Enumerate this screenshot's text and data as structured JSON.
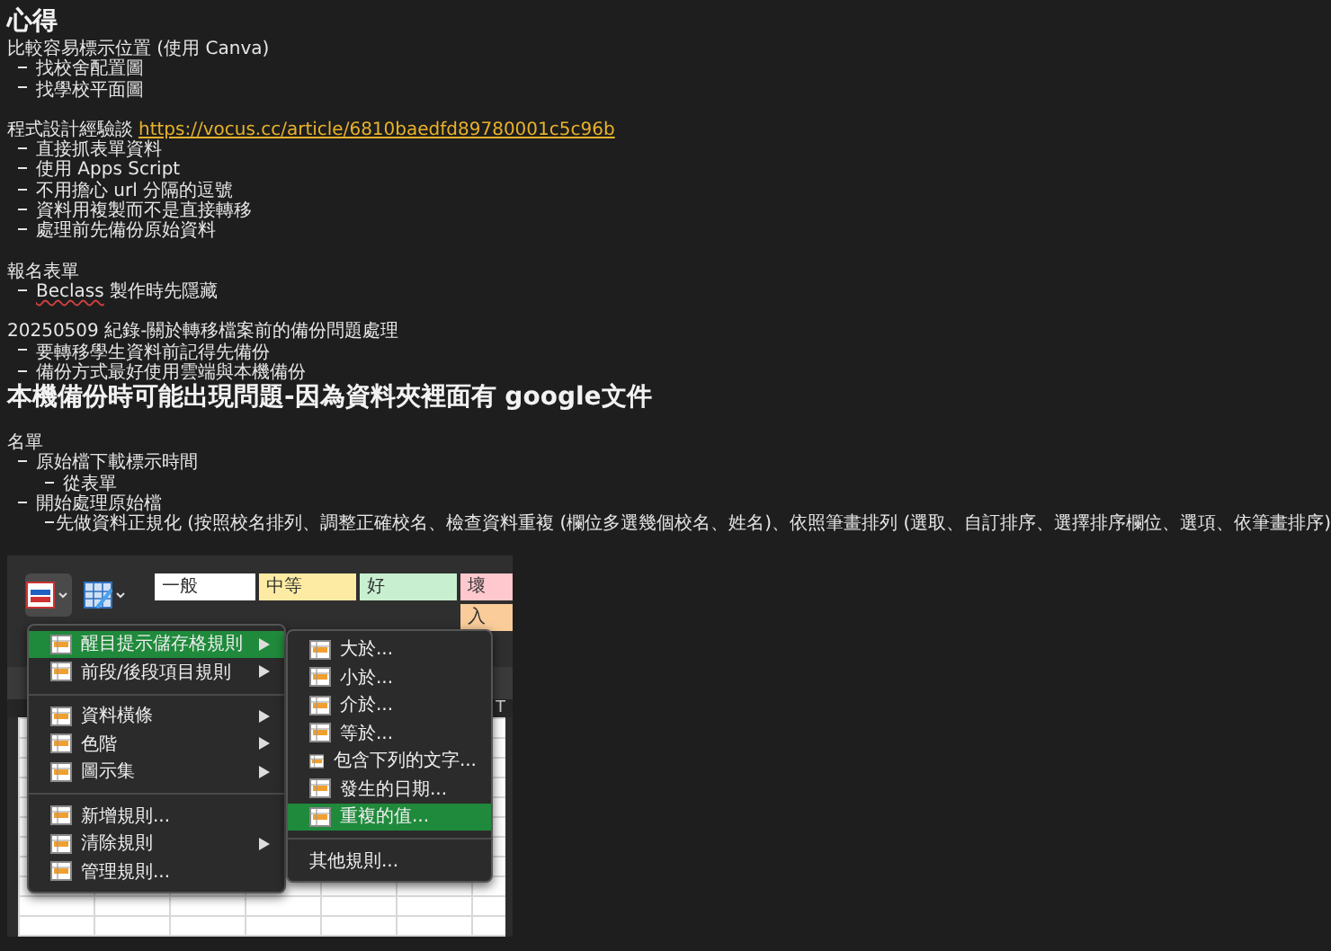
{
  "title": "心得",
  "blocks": [
    {
      "kind": "para",
      "text": "比較容易標示位置 (使用 Canva)",
      "items": [
        {
          "text": "找校舍配置圖"
        },
        {
          "text": "找學校平面圖"
        }
      ]
    },
    {
      "kind": "para",
      "text": "程式設計經驗談",
      "link": "https://vocus.cc/article/6810baedfd89780001c5c96b",
      "items": [
        {
          "text": "直接抓表單資料"
        },
        {
          "text": "使用 Apps Script"
        },
        {
          "text": "不用擔心 url 分隔的逗號"
        },
        {
          "text": "資料用複製而不是直接轉移"
        },
        {
          "text": "處理前先備份原始資料"
        }
      ]
    },
    {
      "kind": "para",
      "text": "報名表單",
      "items": [
        {
          "text": "製作時先隱藏",
          "word": "Beclass"
        }
      ]
    },
    {
      "kind": "para",
      "text": "20250509 紀錄-關於轉移檔案前的備份問題處理",
      "items": [
        {
          "text": "要轉移學生資料前記得先備份"
        },
        {
          "text": "備份方式最好使用雲端與本機備份"
        }
      ]
    },
    {
      "kind": "heading",
      "text": "本機備份時可能出現問題-因為資料夾裡面有 google文件"
    },
    {
      "kind": "para",
      "text": "名單",
      "items": [
        {
          "text": "原始檔下載標示時間",
          "children": [
            {
              "text": "從表單"
            }
          ]
        },
        {
          "text": "開始處理原始檔",
          "children": [
            {
              "text": "先做資料正規化 (按照校名排列、調整正確校名、檢查資料重複 (欄位多選幾個校名、姓名)、依照筆畫排列 (選取、自訂排序、選擇排序欄位、選項、依筆畫排序)"
            }
          ]
        }
      ]
    }
  ],
  "excel": {
    "styles": [
      {
        "text": "一般",
        "color": "#ffffff"
      },
      {
        "text": "中等",
        "color": "#fdeba3"
      },
      {
        "text": "好",
        "color": "#c8efcf"
      },
      {
        "text": "壞",
        "color": "#ffc7ce"
      }
    ],
    "hidden_cell": {
      "text": "入",
      "color": "#f9cc9a"
    },
    "column_header": "T",
    "menu": [
      {
        "kind": "item",
        "text": "醒目提示儲存格規則",
        "submenu": true,
        "selected": true
      },
      {
        "kind": "item",
        "text": "前段/後段項目規則",
        "submenu": true,
        "selected": false
      },
      {
        "kind": "separator"
      },
      {
        "kind": "item",
        "text": "資料橫條",
        "submenu": true,
        "selected": false
      },
      {
        "kind": "item",
        "text": "色階",
        "submenu": true,
        "selected": false
      },
      {
        "kind": "item",
        "text": "圖示集",
        "submenu": true,
        "selected": false
      },
      {
        "kind": "separator"
      },
      {
        "kind": "item",
        "text": "新增規則...",
        "submenu": false,
        "selected": false
      },
      {
        "kind": "item",
        "text": "清除規則",
        "submenu": true,
        "selected": false
      },
      {
        "kind": "item",
        "text": "管理規則...",
        "submenu": false,
        "selected": false
      }
    ],
    "submenu": [
      {
        "kind": "item",
        "text": "大於...",
        "icon": true,
        "selected": false
      },
      {
        "kind": "item",
        "text": "小於...",
        "icon": true,
        "selected": false
      },
      {
        "kind": "item",
        "text": "介於...",
        "icon": true,
        "selected": false
      },
      {
        "kind": "item",
        "text": "等於...",
        "icon": true,
        "selected": false
      },
      {
        "kind": "item",
        "text": "包含下列的文字...",
        "icon": true,
        "selected": false
      },
      {
        "kind": "item",
        "text": "發生的日期...",
        "icon": true,
        "selected": false
      },
      {
        "kind": "item",
        "text": "重複的值...",
        "icon": true,
        "selected": true
      },
      {
        "kind": "separator"
      },
      {
        "kind": "item",
        "text": "其他規則...",
        "icon": false,
        "selected": false
      }
    ]
  }
}
